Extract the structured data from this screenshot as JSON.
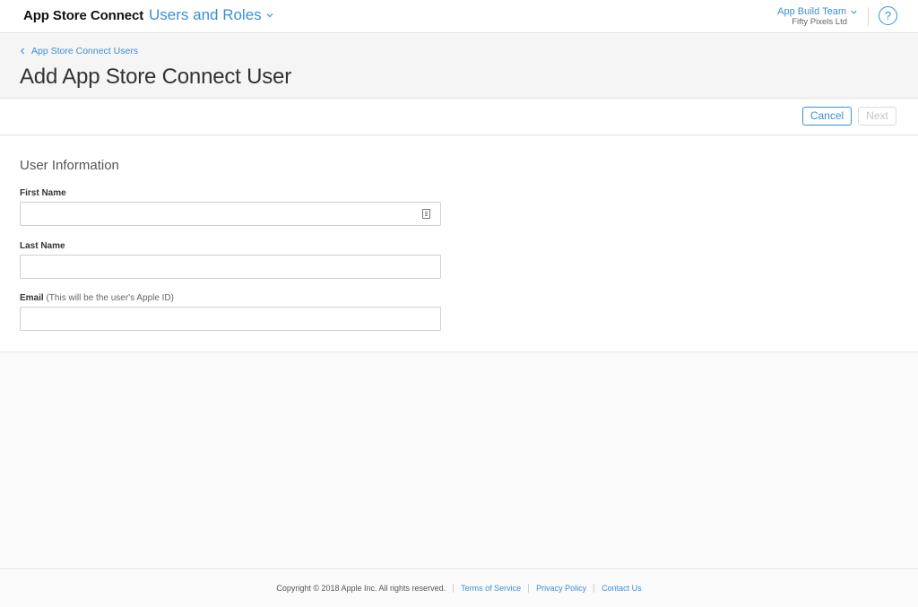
{
  "header": {
    "brand": "App Store Connect",
    "section": "Users and Roles",
    "team_name": "App Build Team",
    "team_org": "Fifty Pixels Ltd",
    "help_label": "?"
  },
  "breadcrumb": {
    "label": "App Store Connect Users"
  },
  "page": {
    "title": "Add App Store Connect User"
  },
  "actions": {
    "cancel_label": "Cancel",
    "next_label": "Next",
    "next_enabled": false
  },
  "form": {
    "section_title": "User Information",
    "first_name": {
      "label": "First Name",
      "value": ""
    },
    "last_name": {
      "label": "Last Name",
      "value": ""
    },
    "email": {
      "label": "Email",
      "hint": "(This will be the user's Apple ID)",
      "value": ""
    }
  },
  "footer": {
    "copyright": "Copyright © 2018 Apple Inc. All rights reserved.",
    "links": [
      "Terms of Service",
      "Privacy Policy",
      "Contact Us"
    ]
  },
  "colors": {
    "accent": "#3a8fd9",
    "disabled": "#c5c5c5"
  },
  "icons": {
    "section_chevron": "chevron-down-icon",
    "team_chevron": "chevron-down-icon",
    "back": "chevron-left-icon",
    "help": "help-icon",
    "autofill": "contact-card-icon"
  }
}
